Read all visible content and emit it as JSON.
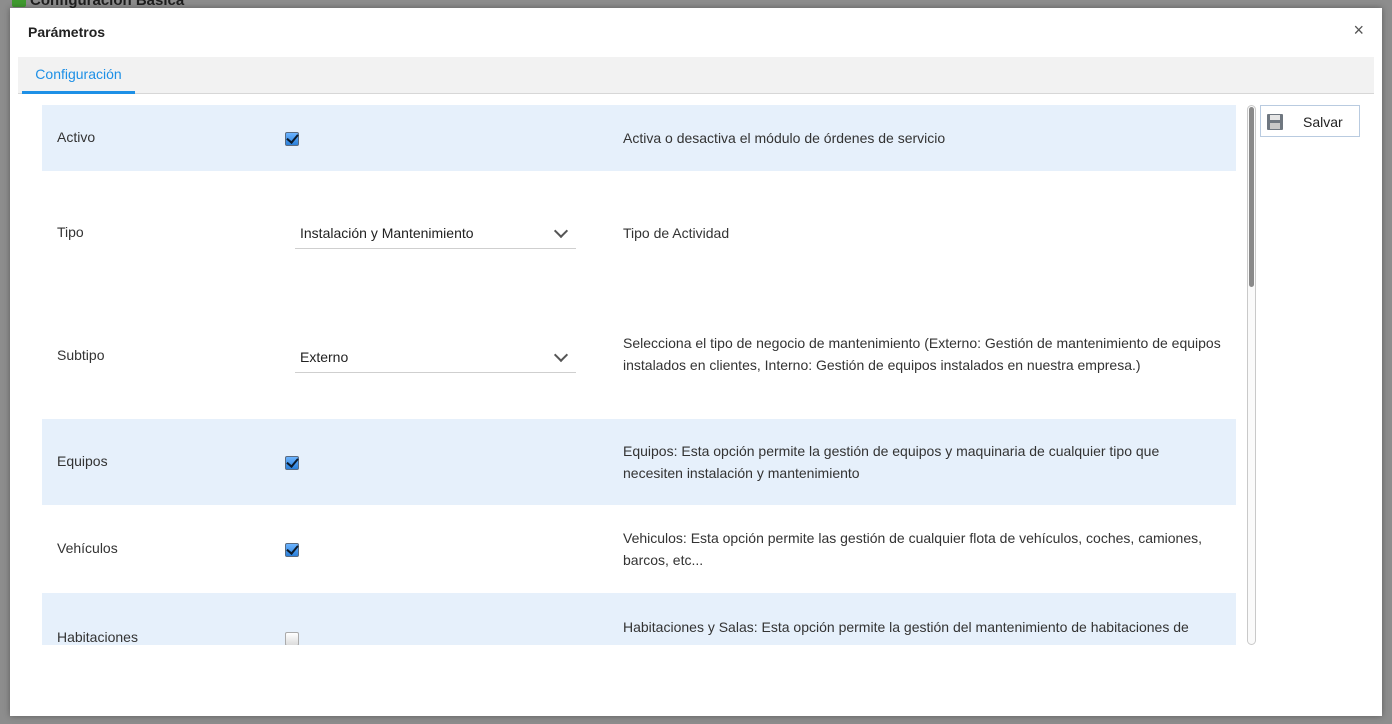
{
  "background": {
    "title": "Configuración Básica"
  },
  "dialog": {
    "title": "Parámetros",
    "close_label": "×"
  },
  "tabs": [
    {
      "label": "Configuración",
      "active": true
    }
  ],
  "toolbar": {
    "save_label": "Salvar",
    "save_icon": "floppy-disk-icon"
  },
  "rows": [
    {
      "label": "Activo",
      "control": "checkbox",
      "checked": true,
      "description": "Activa o desactiva el módulo de órdenes de servicio",
      "shaded": true
    },
    {
      "label": "Tipo",
      "control": "select",
      "value": "Instalación y Mantenimiento",
      "description": "Tipo de Actividad",
      "shaded": false
    },
    {
      "label": "Subtipo",
      "control": "select",
      "value": "Externo",
      "description": "Selecciona el tipo de negocio de mantenimiento (Externo: Gestión de mantenimiento de equipos instalados en clientes, Interno: Gestión de equipos instalados en nuestra empresa.)",
      "shaded": false
    },
    {
      "label": "Equipos",
      "control": "checkbox",
      "checked": true,
      "description": "Equipos: Esta opción permite la gestión de equipos y maquinaria de cualquier tipo que necesiten instalación y mantenimiento",
      "shaded": true
    },
    {
      "label": "Vehículos",
      "control": "checkbox",
      "checked": true,
      "description": "Vehiculos: Esta opción permite las gestión de cualquier flota de vehículos, coches, camiones, barcos, etc...",
      "shaded": false
    },
    {
      "label": "Habitaciones",
      "control": "checkbox",
      "checked": false,
      "description": "Habitaciones y Salas: Esta opción permite la gestión del mantenimiento de habitaciones de",
      "shaded": true
    }
  ],
  "colors": {
    "accent": "#1e90e6",
    "row_shade": "#e6f0fb"
  }
}
